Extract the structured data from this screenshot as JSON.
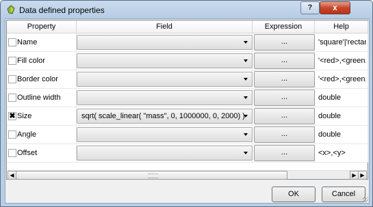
{
  "window": {
    "title": "Data defined properties",
    "help_glyph": "?",
    "close_glyph": "x"
  },
  "table": {
    "headers": [
      "Property",
      "Field",
      "Expression",
      "Help"
    ],
    "rows": [
      {
        "checked": false,
        "property": "Name",
        "field": "",
        "expr": "...",
        "help": "'square'|'rectan..."
      },
      {
        "checked": false,
        "property": "Fill color",
        "field": "",
        "expr": "...",
        "help": "'<red>,<green..."
      },
      {
        "checked": false,
        "property": "Border color",
        "field": "",
        "expr": "...",
        "help": "'<red>,<green..."
      },
      {
        "checked": false,
        "property": "Outline width",
        "field": "",
        "expr": "...",
        "help": "double"
      },
      {
        "checked": true,
        "property": "Size",
        "field": "sqrt( scale_linear(  \"mass\", 0, 1000000, 0, 2000) )",
        "expr": "...",
        "help": "double"
      },
      {
        "checked": false,
        "property": "Angle",
        "field": "",
        "expr": "...",
        "help": "double"
      },
      {
        "checked": false,
        "property": "Offset",
        "field": "",
        "expr": "...",
        "help": "<x>,<y>"
      }
    ],
    "check_mark": "✖"
  },
  "scroll": {
    "left": "◀",
    "right": "▶",
    "right2": "▶"
  },
  "buttons": {
    "ok": "OK",
    "cancel": "Cancel"
  },
  "colors": {
    "title_bar": "#b9cee6",
    "close": "#c9452a"
  }
}
